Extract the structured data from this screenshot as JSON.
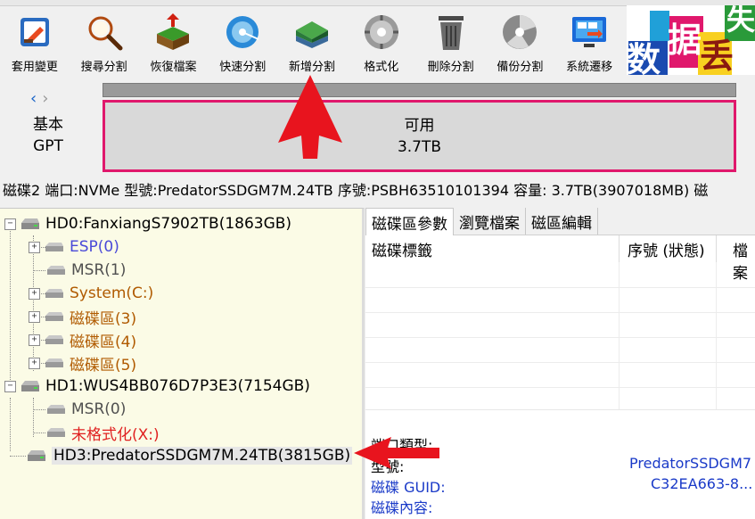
{
  "toolbar": {
    "items": [
      {
        "label": "套用變更",
        "icon": "apply-changes-icon"
      },
      {
        "label": "搜尋分割",
        "icon": "search-partition-icon"
      },
      {
        "label": "恢復檔案",
        "icon": "recover-files-icon"
      },
      {
        "label": "快速分割",
        "icon": "quick-partition-icon"
      },
      {
        "label": "新增分割",
        "icon": "new-partition-icon"
      },
      {
        "label": "格式化",
        "icon": "format-icon"
      },
      {
        "label": "刪除分割",
        "icon": "delete-partition-icon"
      },
      {
        "label": "備份分割",
        "icon": "backup-partition-icon"
      },
      {
        "label": "系統遷移",
        "icon": "system-migration-icon"
      }
    ]
  },
  "logo": {
    "chars": [
      "数",
      "据",
      "丢",
      "失"
    ]
  },
  "disk_view": {
    "nav_left": "‹",
    "nav_right": "›",
    "type_line1": "基本",
    "type_line2": "GPT",
    "partition_label": "可用",
    "partition_size": "3.7TB"
  },
  "disk_info": "磁碟2 端口:NVMe  型號:PredatorSSDGM7M.24TB  序號:PSBH63510101394  容量: 3.7TB(3907018MB)  磁",
  "tree": {
    "disks": [
      {
        "label": "HD0:FanxiangS7902TB(1863GB)"
      },
      {
        "label": "HD1:WUS4BB076D7P3E3(7154GB)"
      },
      {
        "label": "HD3:PredatorSSDGM7M.24TB(3815GB)"
      }
    ],
    "partitions": [
      {
        "label": "ESP(0)",
        "color": "#4a4ad8"
      },
      {
        "label": "MSR(1)",
        "color": "#505050"
      },
      {
        "label": "System(C:)",
        "color": "#b05a00"
      },
      {
        "label": "磁碟區(3)",
        "color": "#b05a00"
      },
      {
        "label": "磁碟區(4)",
        "color": "#b05a00"
      },
      {
        "label": "磁碟區(5)",
        "color": "#b05a00"
      },
      {
        "label": "MSR(0)",
        "color": "#505050"
      },
      {
        "label": "未格式化(X:)",
        "color": "#e02020"
      }
    ]
  },
  "right_panel": {
    "tabs": [
      "磁碟區參數",
      "瀏覽檔案",
      "磁區編輯"
    ],
    "columns": [
      "磁碟標籤",
      "序號 (狀態)",
      "檔案"
    ],
    "props": {
      "port_type_label": "端口類型:",
      "model_label": "型號:",
      "model_value": "PredatorSSDGM7",
      "guid_label": "磁碟 GUID:",
      "guid_value": "C32EA663-8...",
      "contents_label": "磁碟內容:"
    }
  },
  "colors": {
    "accent_border": "#e0186c",
    "annotation_arrow": "#e8141e"
  }
}
